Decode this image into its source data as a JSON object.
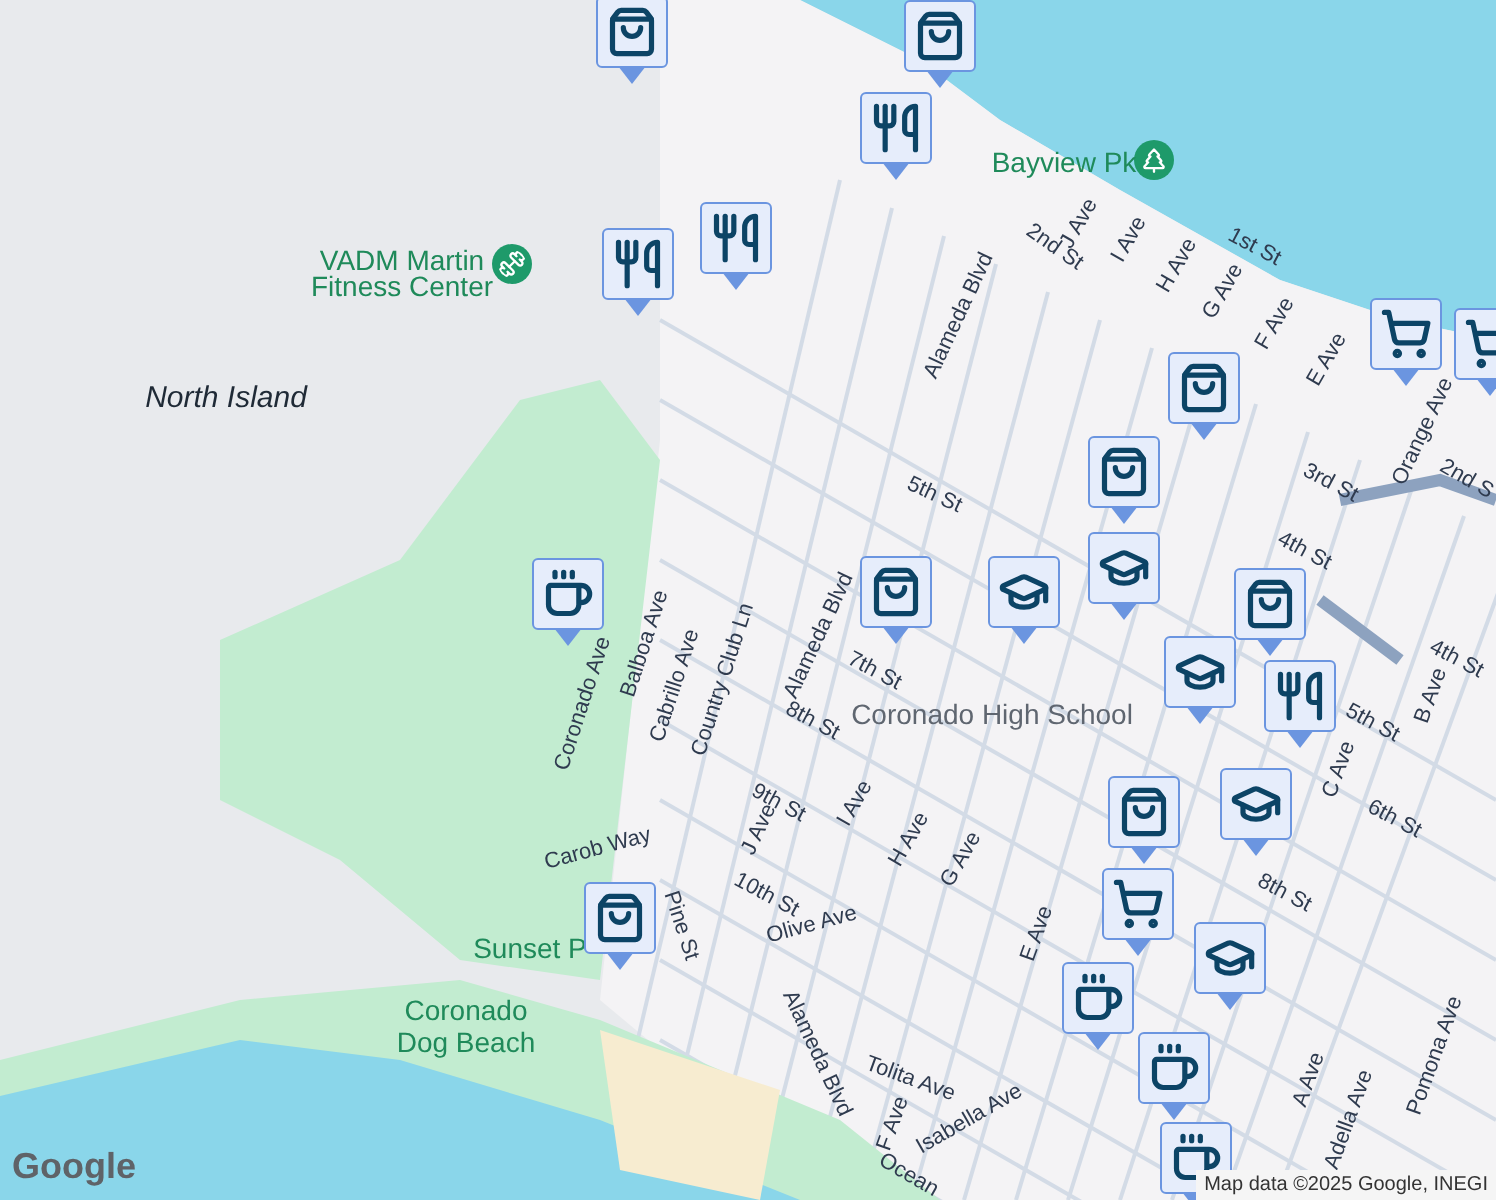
{
  "map": {
    "labels": [
      {
        "text": "North Island",
        "kind": "place"
      },
      {
        "text": "VADM Martin",
        "kind": "park"
      },
      {
        "text": "Fitness Center",
        "kind": "park"
      },
      {
        "text": "Bayview Pk",
        "kind": "park"
      },
      {
        "text": "Alameda Blvd",
        "kind": "street"
      },
      {
        "text": "2nd St",
        "kind": "street"
      },
      {
        "text": "J Ave",
        "kind": "street"
      },
      {
        "text": "I Ave",
        "kind": "street"
      },
      {
        "text": "H Ave",
        "kind": "street"
      },
      {
        "text": "G Ave",
        "kind": "street"
      },
      {
        "text": "F Ave",
        "kind": "street"
      },
      {
        "text": "E Ave",
        "kind": "street"
      },
      {
        "text": "1st St",
        "kind": "street"
      },
      {
        "text": "3rd St",
        "kind": "street"
      },
      {
        "text": "4th St",
        "kind": "street"
      },
      {
        "text": "5th St",
        "kind": "street"
      },
      {
        "text": "Orange Ave",
        "kind": "street"
      },
      {
        "text": "2nd S",
        "kind": "street"
      },
      {
        "text": "Alameda Blvd",
        "kind": "street"
      },
      {
        "text": "7th St",
        "kind": "street"
      },
      {
        "text": "8th St",
        "kind": "street"
      },
      {
        "text": "9th St",
        "kind": "street"
      },
      {
        "text": "10th St",
        "kind": "street"
      },
      {
        "text": "Olive Ave",
        "kind": "street"
      },
      {
        "text": "Alameda Blvd",
        "kind": "street"
      },
      {
        "text": "Tolita Ave",
        "kind": "street"
      },
      {
        "text": "Isabella Ave",
        "kind": "street"
      },
      {
        "text": "F Ave",
        "kind": "street"
      },
      {
        "text": "Ocean",
        "kind": "street"
      },
      {
        "text": "Coronado High School",
        "kind": "poi"
      },
      {
        "text": "I Ave",
        "kind": "street"
      },
      {
        "text": "H Ave",
        "kind": "street"
      },
      {
        "text": "G Ave",
        "kind": "street"
      },
      {
        "text": "E Ave",
        "kind": "street"
      },
      {
        "text": "C Ave",
        "kind": "street"
      },
      {
        "text": "B Ave",
        "kind": "street"
      },
      {
        "text": "5th St",
        "kind": "street"
      },
      {
        "text": "6th St",
        "kind": "street"
      },
      {
        "text": "4th St",
        "kind": "street"
      },
      {
        "text": "A Ave",
        "kind": "street"
      },
      {
        "text": "Adella Ave",
        "kind": "street"
      },
      {
        "text": "Pomona Ave",
        "kind": "street"
      },
      {
        "text": "8th St",
        "kind": "street"
      },
      {
        "text": "Coronado Ave",
        "kind": "street"
      },
      {
        "text": "Balboa Ave",
        "kind": "street"
      },
      {
        "text": "Cabrillo Ave",
        "kind": "street"
      },
      {
        "text": "Country Club Ln",
        "kind": "street"
      },
      {
        "text": "Carob Way",
        "kind": "street"
      },
      {
        "text": "Pine St",
        "kind": "street"
      },
      {
        "text": "J Ave",
        "kind": "street"
      },
      {
        "text": "Sunset P",
        "kind": "park"
      },
      {
        "text": "Coronado",
        "kind": "park"
      },
      {
        "text": "Dog Beach",
        "kind": "park"
      }
    ],
    "markers": [
      {
        "kind": "bag"
      },
      {
        "kind": "bag"
      },
      {
        "kind": "food"
      },
      {
        "kind": "food"
      },
      {
        "kind": "food"
      },
      {
        "kind": "bag"
      },
      {
        "kind": "cart"
      },
      {
        "kind": "cart"
      },
      {
        "kind": "bag"
      },
      {
        "kind": "school"
      },
      {
        "kind": "bag"
      },
      {
        "kind": "school"
      },
      {
        "kind": "bag"
      },
      {
        "kind": "school"
      },
      {
        "kind": "food"
      },
      {
        "kind": "school"
      },
      {
        "kind": "coffee"
      },
      {
        "kind": "bag"
      },
      {
        "kind": "bag"
      },
      {
        "kind": "cart"
      },
      {
        "kind": "school"
      },
      {
        "kind": "coffee"
      },
      {
        "kind": "coffee"
      },
      {
        "kind": "coffee"
      }
    ],
    "attribution": "Map data ©2025 Google, INEGI",
    "logo": "Google"
  }
}
